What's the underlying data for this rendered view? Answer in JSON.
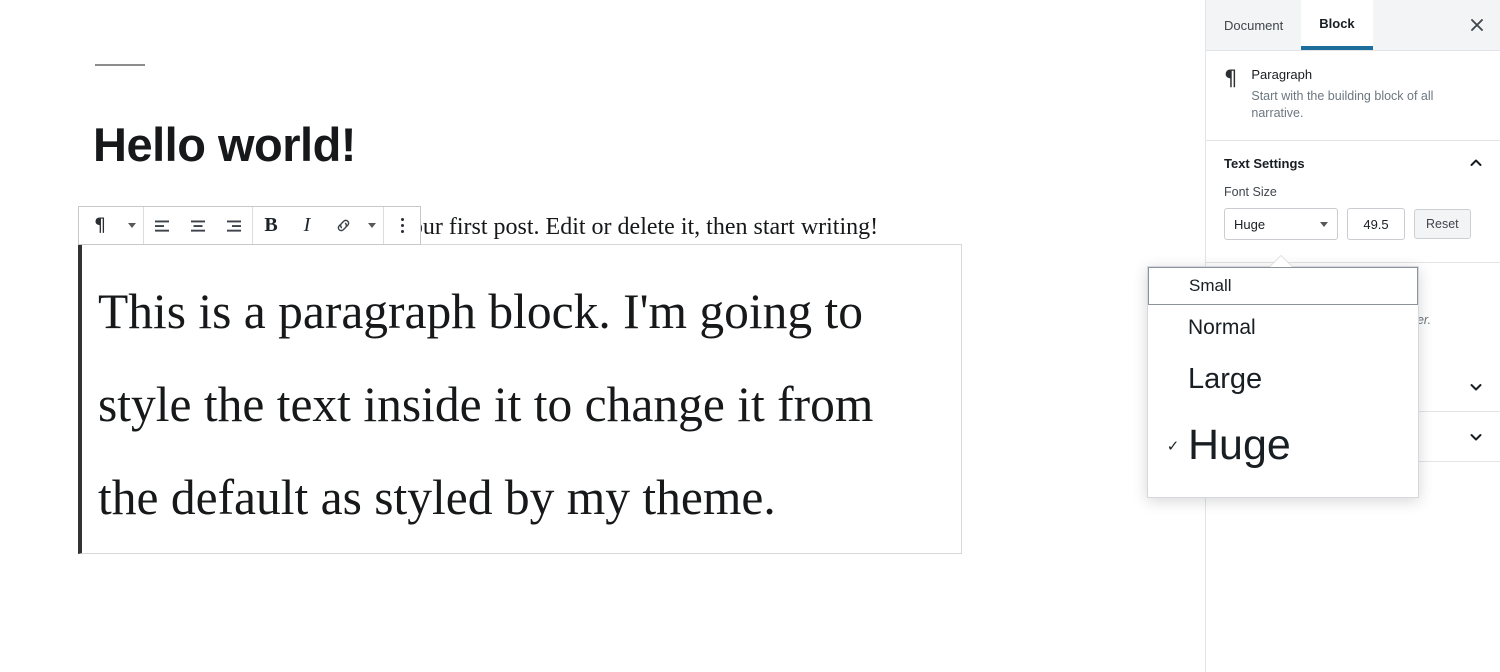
{
  "editor": {
    "post_title": "Hello world!",
    "intro_paragraph": "Welcome to WordPress. This is your first post. Edit or delete it, then start writing!",
    "selected_block_text": "This is a paragraph block. I'm going to style the text inside it to change it from the default as styled by my theme."
  },
  "toolbar": {
    "block_type_icon": "¶",
    "block_type_label": "Paragraph block type",
    "align_left_label": "Align left",
    "align_center_label": "Align center",
    "align_right_label": "Align right",
    "bold_label": "B",
    "italic_label": "I",
    "link_label": "Link",
    "more_rich_text_label": "More rich text controls",
    "more_options_label": "More options"
  },
  "sidebar": {
    "tabs": [
      {
        "label": "Document",
        "active": false
      },
      {
        "label": "Block",
        "active": true
      }
    ],
    "close_label": "Close settings",
    "block_card": {
      "icon": "¶",
      "title": "Paragraph",
      "description": "Start with the building block of all narrative."
    },
    "text_settings": {
      "title": "Text Settings",
      "font_size_label": "Font Size",
      "font_size_selected": "Huge",
      "font_size_value": "49.5",
      "reset_label": "Reset"
    },
    "occluded_text": "tter.",
    "collapsed_panels": [
      {
        "title": ""
      },
      {
        "title": ""
      }
    ]
  },
  "font_size_dropdown": {
    "options": [
      {
        "label": "Small",
        "checked": false,
        "focused": true
      },
      {
        "label": "Normal",
        "checked": false,
        "focused": false
      },
      {
        "label": "Large",
        "checked": false,
        "focused": false
      },
      {
        "label": "Huge",
        "checked": true,
        "focused": false
      }
    ],
    "check_glyph": "✓"
  },
  "colors": {
    "accent_blue": "#1e6e9c",
    "text_dark": "#191e23",
    "text_muted": "#6c7781",
    "border": "#e2e4e7",
    "selection_border": "#2f3336"
  }
}
